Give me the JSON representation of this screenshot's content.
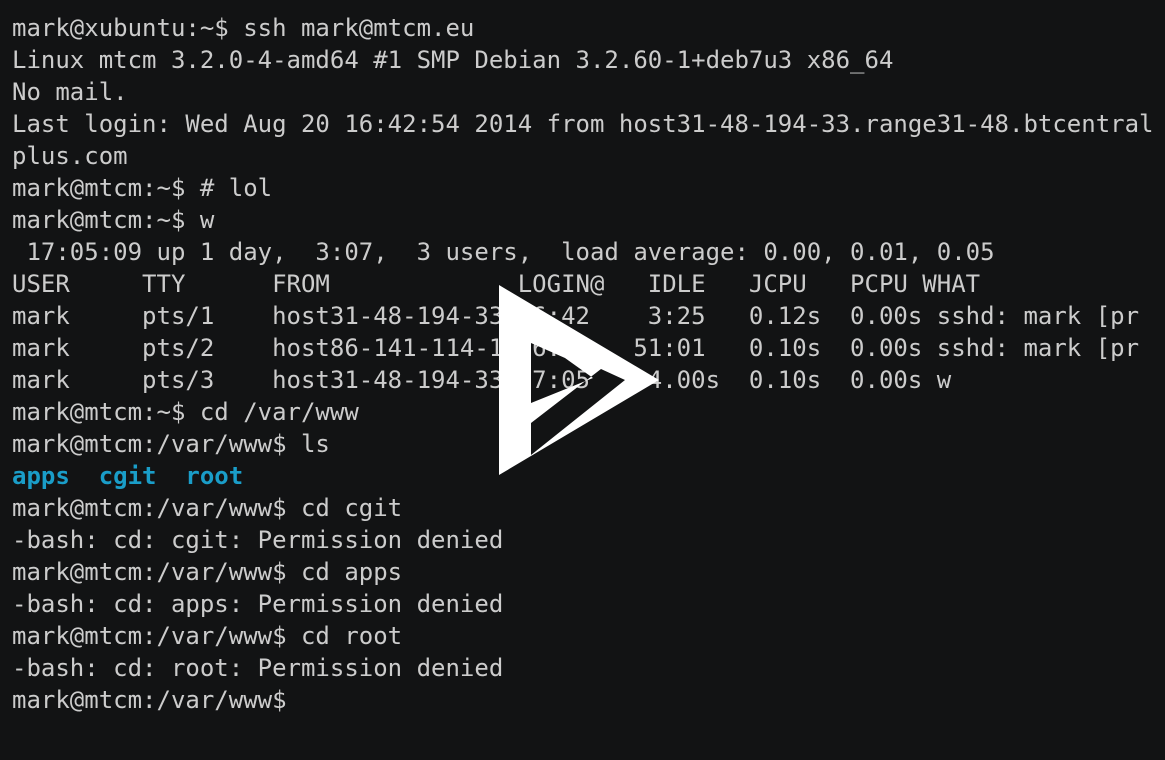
{
  "terminal": {
    "lines": [
      "mark@xubuntu:~$ ssh mark@mtcm.eu",
      "Linux mtcm 3.2.0-4-amd64 #1 SMP Debian 3.2.60-1+deb7u3 x86_64",
      "No mail.",
      "Last login: Wed Aug 20 16:42:54 2014 from host31-48-194-33.range31-48.btcentral",
      "plus.com",
      "mark@mtcm:~$ # lol",
      "mark@mtcm:~$ w",
      " 17:05:09 up 1 day,  3:07,  3 users,  load average: 0.00, 0.01, 0.05",
      "USER     TTY      FROM             LOGIN@   IDLE   JCPU   PCPU WHAT",
      "mark     pts/1    host31-48-194-33 16:42    3:25   0.12s  0.00s sshd: mark [pr",
      "mark     pts/2    host86-141-114-1 16:14   51:01   0.10s  0.00s sshd: mark [pr",
      "mark     pts/3    host31-48-194-33 17:05    4.00s  0.10s  0.00s w",
      "mark@mtcm:~$ cd /var/www",
      "mark@mtcm:/var/www$ ls"
    ],
    "ls_output": {
      "entries": [
        "apps",
        "cgit",
        "root"
      ],
      "color": "#1a9dc8"
    },
    "lines_after": [
      "mark@mtcm:/var/www$ cd cgit",
      "-bash: cd: cgit: Permission denied",
      "mark@mtcm:/var/www$ cd apps",
      "-bash: cd: apps: Permission denied",
      "mark@mtcm:/var/www$ cd root",
      "-bash: cd: root: Permission denied",
      "mark@mtcm:/var/www$"
    ],
    "background": "#121314",
    "foreground": "#cccccc"
  },
  "overlay": {
    "icon": "play-icon",
    "color": "#ffffff"
  }
}
